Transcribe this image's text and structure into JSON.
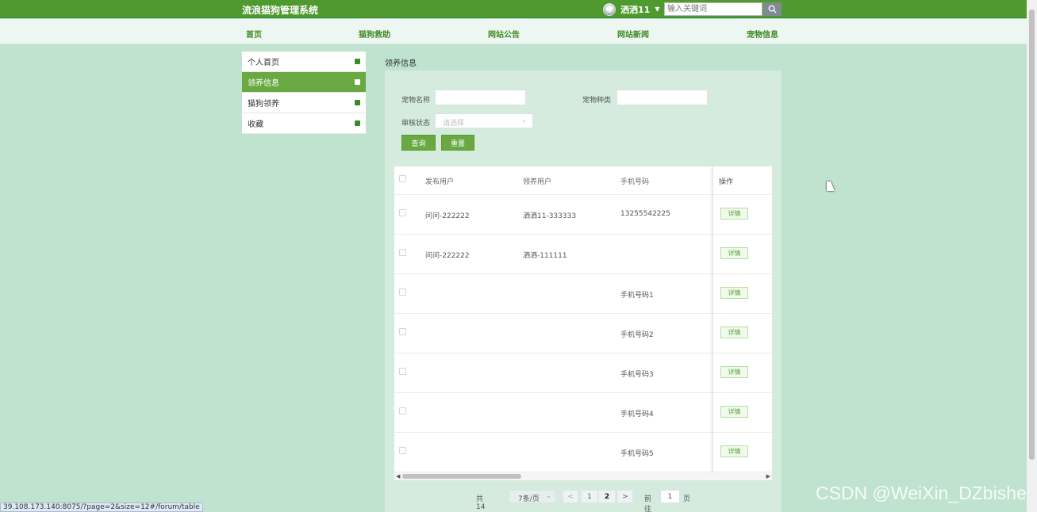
{
  "header": {
    "title": "流浪猫狗管理系统",
    "user_name": "洒洒11",
    "search_placeholder": "输入关键词"
  },
  "nav": [
    "首页",
    "猫狗救助",
    "网站公告",
    "网站新闻",
    "宠物信息"
  ],
  "sidebar": [
    {
      "label": "个人首页",
      "active": false
    },
    {
      "label": "领养信息",
      "active": true
    },
    {
      "label": "猫狗领养",
      "active": false
    },
    {
      "label": "收藏",
      "active": false
    }
  ],
  "breadcrumb": "领养信息",
  "filters": {
    "pet_name_label": "宠物名称",
    "pet_type_label": "宠物种类",
    "status_label": "审核状态",
    "status_placeholder": "请选择",
    "query_button": "查询",
    "reset_button": "重置"
  },
  "table": {
    "headers": [
      "发布用户",
      "领养用户",
      "手机号码",
      "操作"
    ],
    "rows": [
      {
        "publisher": "问问-222222",
        "adopter": "洒洒11-333333",
        "phone": "13255542225",
        "action": "详情"
      },
      {
        "publisher": "问问-222222",
        "adopter": "洒洒-111111",
        "phone": "",
        "action": "详情"
      },
      {
        "publisher": "",
        "adopter": "",
        "phone": "手机号码1",
        "action": "详情"
      },
      {
        "publisher": "",
        "adopter": "",
        "phone": "手机号码2",
        "action": "详情"
      },
      {
        "publisher": "",
        "adopter": "",
        "phone": "手机号码3",
        "action": "详情"
      },
      {
        "publisher": "",
        "adopter": "",
        "phone": "手机号码4",
        "action": "详情"
      },
      {
        "publisher": "",
        "adopter": "",
        "phone": "手机号码5",
        "action": "详情"
      }
    ]
  },
  "pagination": {
    "total": "共 14 条",
    "page_size": "7条/页",
    "prev": "<",
    "pages": [
      "1",
      "2"
    ],
    "current_page": "2",
    "next": ">",
    "jump_label": "前往",
    "jump_value": "1",
    "jump_unit": "页"
  },
  "status_url": "39.108.173.140:8075/?page=2&size=12#/forum/table",
  "watermark": "CSDN @WeiXin_DZbishe",
  "colors": {
    "primary": "#4f9a2e",
    "accent": "#6aa942",
    "background": "#bfe3cf"
  }
}
